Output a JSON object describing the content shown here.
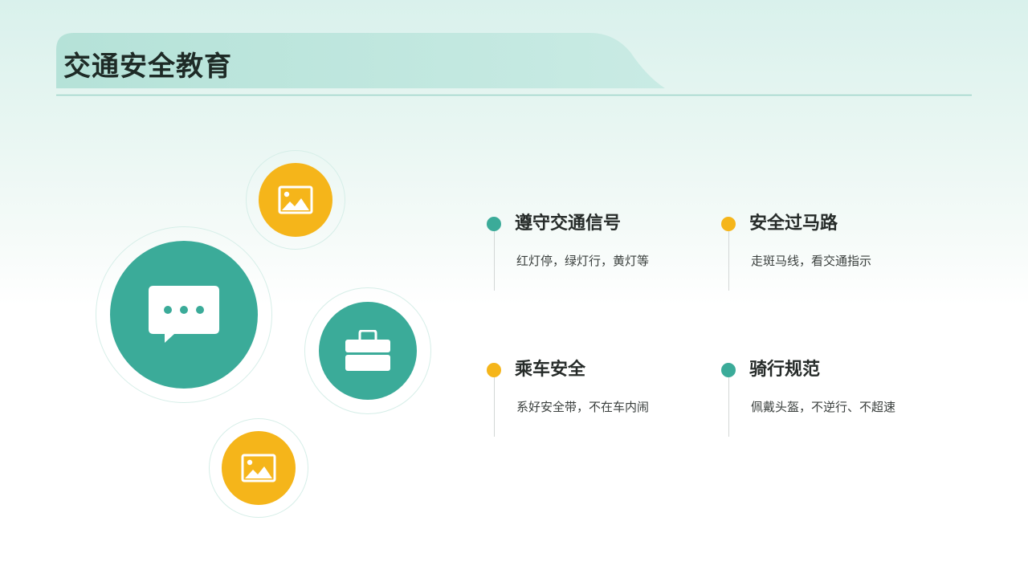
{
  "title": "交通安全教育",
  "colors": {
    "teal": "#3bab99",
    "yellow": "#f5b51a",
    "header_band": "#b9e4db",
    "text_dark": "#262b29"
  },
  "icons": [
    {
      "name": "image-icon",
      "color": "yellow"
    },
    {
      "name": "chat-icon",
      "color": "teal"
    },
    {
      "name": "briefcase-icon",
      "color": "teal"
    },
    {
      "name": "image-icon",
      "color": "yellow"
    }
  ],
  "items": [
    {
      "title": "遵守交通信号",
      "desc": "红灯停，绿灯行，黄灯等",
      "dot_color": "teal"
    },
    {
      "title": "安全过马路",
      "desc": "走斑马线，看交通指示",
      "dot_color": "yellow"
    },
    {
      "title": "乘车安全",
      "desc": "系好安全带，不在车内闹",
      "dot_color": "yellow"
    },
    {
      "title": "骑行规范",
      "desc": "佩戴头盔，不逆行、不超速",
      "dot_color": "teal"
    }
  ]
}
